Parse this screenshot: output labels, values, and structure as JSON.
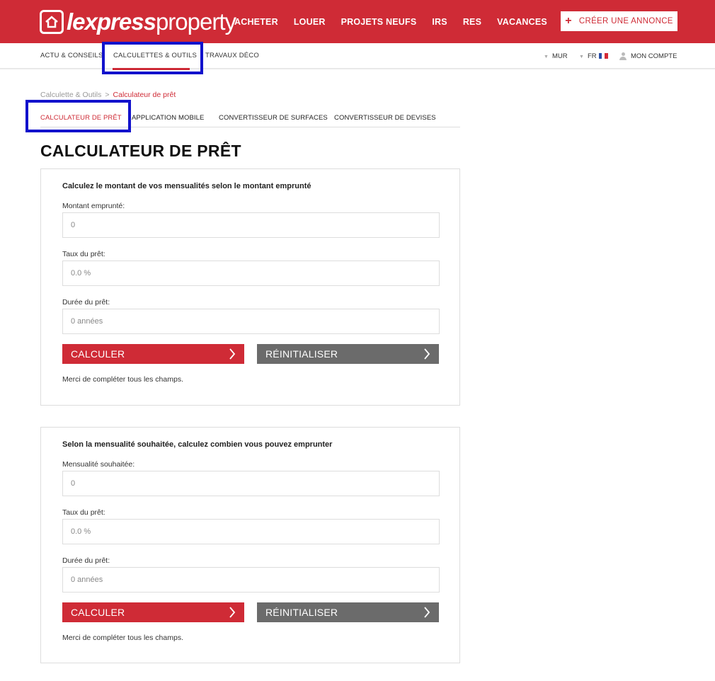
{
  "header": {
    "logo_bold": "lexpress",
    "logo_light": "property",
    "nav": [
      "ACHETER",
      "LOUER",
      "PROJETS NEUFS",
      "IRS",
      "RES",
      "VACANCES"
    ],
    "create_label": "CRÉER UNE ANNONCE",
    "brand_color": "#cf2b36"
  },
  "subnav": {
    "items": [
      "ACTU & CONSEILS",
      "CALCULETTES & OUTILS",
      "TRAVAUX DÉCO"
    ],
    "active": "CALCULETTES & OUTILS",
    "currency": "MUR",
    "language": "FR",
    "account": "MON COMPTE"
  },
  "breadcrumb": {
    "parent": "Calculette & Outils",
    "separator": ">",
    "current": "Calculateur de prêt"
  },
  "tabs": [
    "CALCULATEUR DE PRÊT",
    "APPLICATION MOBILE",
    "CONVERTISSEUR DE SURFACES",
    "CONVERTISSEUR DE DEVISES"
  ],
  "page_title": "CALCULATEUR DE PRÊT",
  "calc1": {
    "title": "Calculez le montant de vos mensualités selon le montant emprunté",
    "amount_label": "Montant emprunté:",
    "amount_placeholder": "0",
    "rate_label": "Taux du prêt:",
    "rate_placeholder": "0.0 %",
    "duration_label": "Durée du prêt:",
    "duration_placeholder": "0 années",
    "calc_button": "CALCULER",
    "reset_button": "RÉINITIALISER",
    "note": "Merci de compléter tous les champs."
  },
  "calc2": {
    "title": "Selon la mensualité souhaitée, calculez combien vous pouvez emprunter",
    "amount_label": "Mensualité souhaitée:",
    "amount_placeholder": "0",
    "rate_label": "Taux du prêt:",
    "rate_placeholder": "0.0 %",
    "duration_label": "Durée du prêt:",
    "duration_placeholder": "0 années",
    "calc_button": "CALCULER",
    "reset_button": "RÉINITIALISER",
    "note": "Merci de compléter tous les champs."
  }
}
